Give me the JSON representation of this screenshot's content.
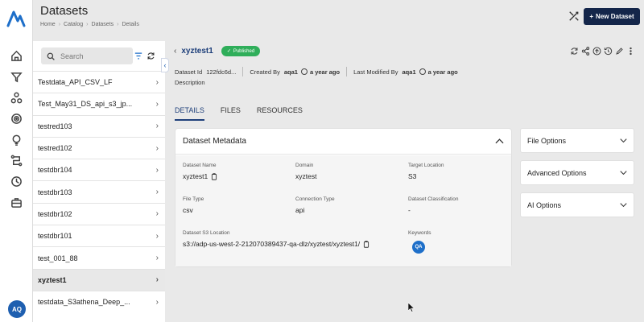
{
  "header": {
    "title": "Datasets",
    "breadcrumb": [
      "Home",
      "Catalog",
      "Datasets",
      "Details"
    ],
    "new_button_label": "New Dataset",
    "new_button_icon": "plus-icon",
    "tool_icon": "tools-icon"
  },
  "rail": {
    "logo_icon": "brand-logo-icon",
    "items": [
      "home-icon",
      "funnel-icon",
      "network-icon",
      "target-icon",
      "lightbulb-icon",
      "pipeline-icon",
      "clock-icon",
      "briefcase-icon"
    ],
    "avatar_initials": "AQ"
  },
  "list_panel": {
    "search_placeholder": "Search",
    "items": [
      {
        "label": "Testdata_API_CSV_LF",
        "active": false
      },
      {
        "label": "Test_May31_DS_api_s3_jp...",
        "active": false
      },
      {
        "label": "testred103",
        "active": false
      },
      {
        "label": "testred102",
        "active": false
      },
      {
        "label": "testdbr104",
        "active": false
      },
      {
        "label": "testdbr103",
        "active": false
      },
      {
        "label": "testdbr102",
        "active": false
      },
      {
        "label": "testdbr101",
        "active": false
      },
      {
        "label": "test_001_88",
        "active": false
      },
      {
        "label": "xyztest1",
        "active": true
      },
      {
        "label": "testdata_S3athena_Deep_...",
        "active": false
      }
    ]
  },
  "detail": {
    "name": "xyztest1",
    "status": "Published",
    "dataset_id_label": "Dataset Id",
    "dataset_id": "122fdc6d...",
    "created_by_label": "Created By",
    "created_by": "aqa1",
    "created_time": "a year ago",
    "modified_by_label": "Last Modified By",
    "modified_by": "aqa1",
    "modified_time": "a year ago",
    "description_label": "Description",
    "action_icons": [
      "refresh-icon",
      "share-icon",
      "upload-icon",
      "history-icon",
      "edit-icon",
      "more-icon"
    ]
  },
  "tabs": [
    {
      "label": "DETAILS",
      "active": true
    },
    {
      "label": "FILES",
      "active": false
    },
    {
      "label": "RESOURCES",
      "active": false
    }
  ],
  "metadata": {
    "title": "Dataset Metadata",
    "dataset_name_label": "Dataset Name",
    "dataset_name": "xyztest1",
    "domain_label": "Domain",
    "domain": "xyztest",
    "target_location_label": "Target Location",
    "target_location": "S3",
    "file_type_label": "File Type",
    "file_type": "csv",
    "connection_type_label": "Connection Type",
    "connection_type": "api",
    "classification_label": "Dataset Classification",
    "classification": "-",
    "s3_location_label": "Dataset S3 Location",
    "s3_location": "s3://adp-us-west-2-212070389437-qa-dlz/xyztest/xyztest1/",
    "keywords_label": "Keywords",
    "keyword_badge": "QA"
  },
  "options": [
    {
      "label": "File Options"
    },
    {
      "label": "Advanced Options"
    },
    {
      "label": "AI Options"
    }
  ],
  "colors": {
    "accent": "#1e3f7a",
    "published": "#2fae5a",
    "new_button": "#14264a",
    "avatar": "#1e5fb0"
  }
}
